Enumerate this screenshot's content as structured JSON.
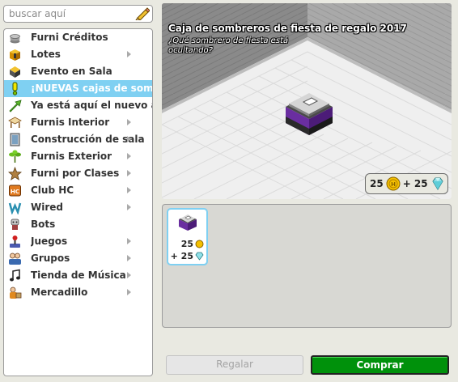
{
  "search": {
    "placeholder": "buscar aquí"
  },
  "categories": [
    {
      "label": "Furni Créditos",
      "icon": "stack-icon",
      "arrow": false,
      "selected": false
    },
    {
      "label": "Lotes",
      "icon": "package-icon",
      "arrow": true,
      "selected": false
    },
    {
      "label": "Evento en Sala",
      "icon": "event-icon",
      "arrow": false,
      "selected": false
    },
    {
      "label": "¡NUEVAS cajas de sombrer",
      "icon": "exclamation-icon",
      "arrow": false,
      "selected": true
    },
    {
      "label": "Ya está aquí el nuevo año",
      "icon": "arrow-up-icon",
      "arrow": false,
      "selected": false
    },
    {
      "label": "Furnis Interior",
      "icon": "table-icon",
      "arrow": true,
      "selected": false
    },
    {
      "label": "Construcción de sala",
      "icon": "door-icon",
      "arrow": true,
      "selected": false
    },
    {
      "label": "Furnis Exterior",
      "icon": "plant-icon",
      "arrow": true,
      "selected": false
    },
    {
      "label": "Furni por Clases",
      "icon": "star-icon",
      "arrow": true,
      "selected": false
    },
    {
      "label": "Club HC",
      "icon": "hc-icon",
      "arrow": true,
      "selected": false
    },
    {
      "label": "Wired",
      "icon": "wired-icon",
      "arrow": true,
      "selected": false
    },
    {
      "label": "Bots",
      "icon": "bot-icon",
      "arrow": false,
      "selected": false
    },
    {
      "label": "Juegos",
      "icon": "joystick-icon",
      "arrow": true,
      "selected": false
    },
    {
      "label": "Grupos",
      "icon": "group-icon",
      "arrow": true,
      "selected": false
    },
    {
      "label": "Tienda de Música",
      "icon": "music-note-icon",
      "arrow": true,
      "selected": false
    },
    {
      "label": "Mercadillo",
      "icon": "market-icon",
      "arrow": true,
      "selected": false
    }
  ],
  "preview": {
    "title": "Caja de sombreros de fiesta de regalo 2017",
    "description": "¿Qué sombrero de fiesta está ocultando?",
    "price_credits": "25",
    "price_diamonds": "+ 25"
  },
  "offer": {
    "price_credits": "25",
    "price_diamonds": "+ 25"
  },
  "buttons": {
    "gift": "Regalar",
    "buy": "Comprar"
  },
  "colors": {
    "selected": "#7fd0f2",
    "buy": "#00910b",
    "box_purple": "#6a2ea0"
  }
}
